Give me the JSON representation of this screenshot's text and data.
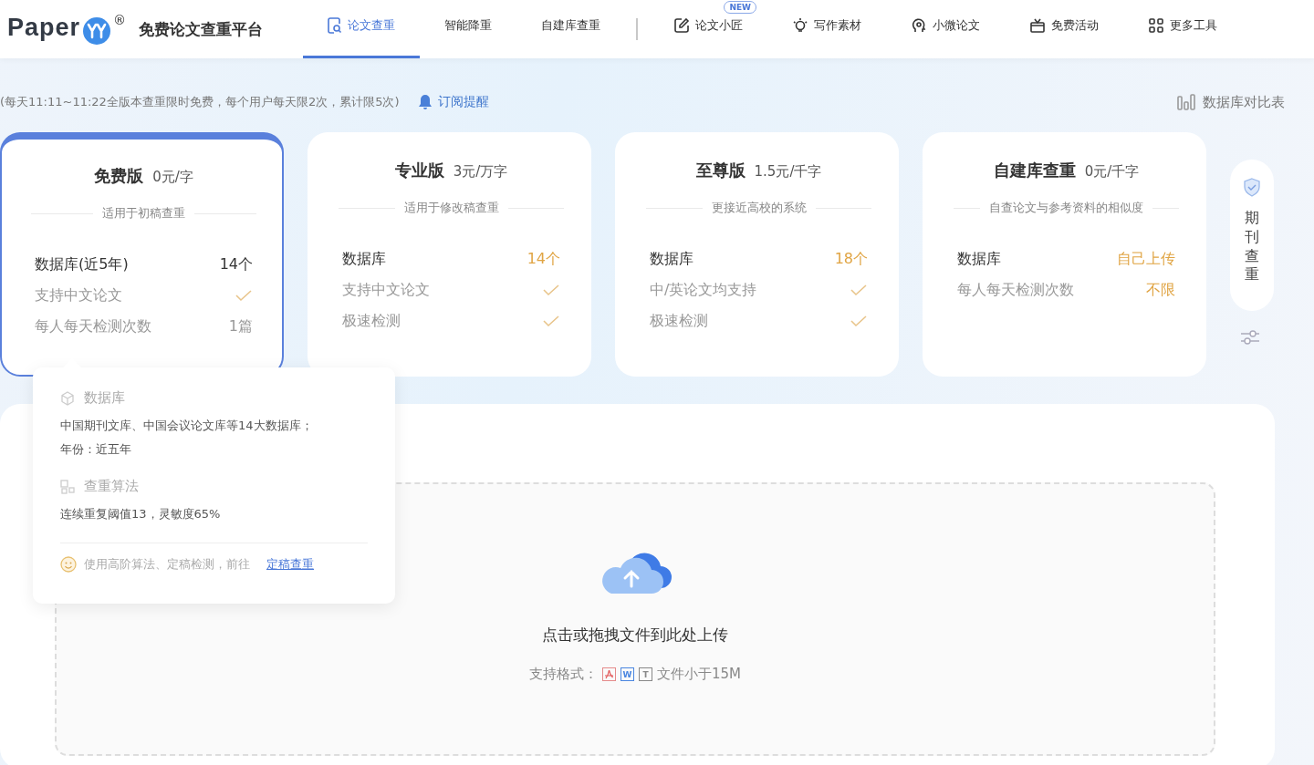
{
  "header": {
    "logo_text": "Paper",
    "logo_mark": "®",
    "site_title": "免费论文查重平台",
    "nav": [
      {
        "label": "论文查重",
        "selected": true
      },
      {
        "label": "智能降重",
        "selected": false
      },
      {
        "label": "自建库查重",
        "selected": false
      },
      {
        "kind": "divider"
      },
      {
        "label": "论文小匠",
        "badge": "NEW",
        "selected": false
      },
      {
        "label": "写作素材",
        "selected": false
      },
      {
        "label": "小微论文",
        "selected": false
      },
      {
        "label": "免费活动",
        "selected": false
      },
      {
        "label": "更多工具",
        "selected": false
      }
    ]
  },
  "notice": {
    "text": "(每天11:11~11:22全版本查重限时免费，每个用户每天限2次，累计限5次)",
    "subscribe": "订阅提醒",
    "compare": "数据库对比表"
  },
  "plans": [
    {
      "name": "免费版",
      "price": "0元/字",
      "subtitle": "适用于初稿查重",
      "selected": true,
      "rows": [
        {
          "label": "数据库(近5年)",
          "primary": true,
          "kind": "text",
          "value": "14个",
          "accent": false
        },
        {
          "label": "支持中文论文",
          "primary": false,
          "kind": "check"
        },
        {
          "label": "每人每天检测次数",
          "primary": false,
          "kind": "text",
          "value": "1篇",
          "accent": false
        }
      ]
    },
    {
      "name": "专业版",
      "price": "3元/万字",
      "subtitle": "适用于修改稿查重",
      "selected": false,
      "rows": [
        {
          "label": "数据库",
          "primary": true,
          "kind": "text",
          "value": "14个",
          "accent": true
        },
        {
          "label": "支持中文论文",
          "primary": false,
          "kind": "check"
        },
        {
          "label": "极速检测",
          "primary": false,
          "kind": "check"
        }
      ]
    },
    {
      "name": "至尊版",
      "price": "1.5元/千字",
      "subtitle": "更接近高校的系统",
      "selected": false,
      "rows": [
        {
          "label": "数据库",
          "primary": true,
          "kind": "text",
          "value": "18个",
          "accent": true
        },
        {
          "label": "中/英论文均支持",
          "primary": false,
          "kind": "check"
        },
        {
          "label": "极速检测",
          "primary": false,
          "kind": "check"
        }
      ]
    },
    {
      "name": "自建库查重",
      "price": "0元/千字",
      "subtitle": "自查论文与参考资料的相似度",
      "selected": false,
      "rows": [
        {
          "label": "数据库",
          "primary": true,
          "kind": "text",
          "value": "自己上传",
          "accent": true
        },
        {
          "label": "每人每天检测次数",
          "primary": false,
          "kind": "text",
          "value": "不限",
          "accent": true
        }
      ]
    }
  ],
  "side_float": {
    "label": "期刊查重"
  },
  "tooltip": {
    "sections": [
      {
        "title": "数据库",
        "lines": [
          "中国期刊文库、中国会议论文库等14大数据库；",
          "年份：近五年"
        ]
      },
      {
        "title": "查重算法",
        "lines": [
          "连续重复阈值13，灵敏度65%"
        ]
      }
    ],
    "footer": "使用高阶算法、定稿检测，前往",
    "link": "定稿查重"
  },
  "upload": {
    "title": "点击或拖拽文件到此处上传",
    "formats_label": "支持格式：",
    "formats": [
      {
        "kind": "pdf"
      },
      {
        "kind": "word",
        "label": "W"
      },
      {
        "kind": "text",
        "label": "T"
      }
    ],
    "size_note": "文件小于15M"
  }
}
